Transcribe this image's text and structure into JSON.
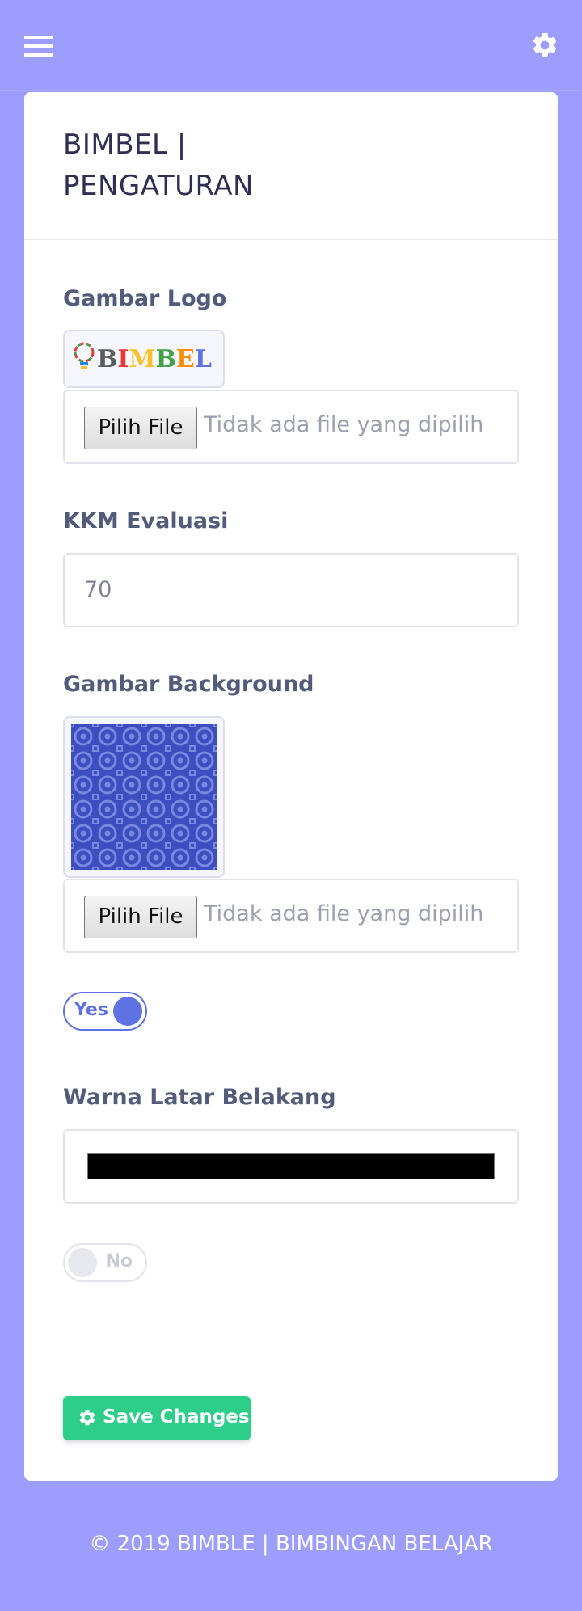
{
  "header": {
    "menu_icon": "hamburger-icon",
    "settings_icon": "gear-icon"
  },
  "card": {
    "title": "BIMBEL | PENGATURAN"
  },
  "logo_section": {
    "label": "Gambar Logo",
    "logo_text": "BIMBEL",
    "file_button": "Pilih File",
    "file_status": "Tidak ada file yang dipilih"
  },
  "kkm_section": {
    "label": "KKM Evaluasi",
    "value": "70"
  },
  "background_section": {
    "label": "Gambar Background",
    "file_button": "Pilih File",
    "file_status": "Tidak ada file yang dipilih",
    "toggle_label": "Yes",
    "toggle_on": true
  },
  "bg_color_section": {
    "label": "Warna Latar Belakang",
    "color_value": "#000000",
    "toggle_label": "No",
    "toggle_on": false
  },
  "actions": {
    "save_label": "Save Changes",
    "save_icon": "gear-icon"
  },
  "footer": {
    "text": "© 2019 BIMBLE | BIMBINGAN BELAJAR"
  },
  "colors": {
    "page_bg": "#9d9dfd",
    "primary": "#5e72e4",
    "success": "#2dce89",
    "title": "#2f2f51"
  }
}
